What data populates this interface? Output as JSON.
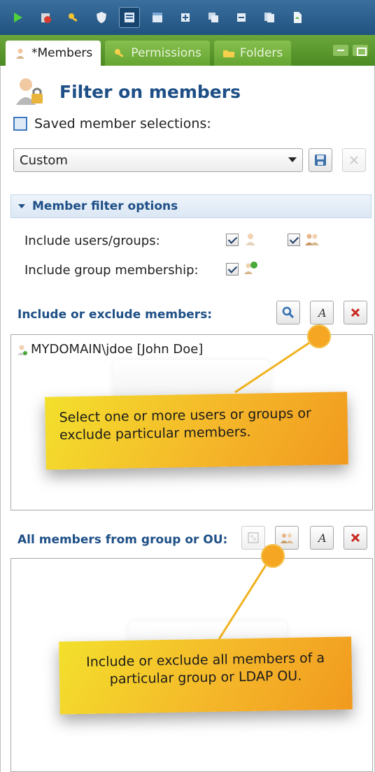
{
  "tabs": [
    {
      "label": "*Members"
    },
    {
      "label": "Permissions"
    },
    {
      "label": "Folders"
    }
  ],
  "header": {
    "title": "Filter on members"
  },
  "saved": {
    "label": "Saved member selections:",
    "selected": "Custom"
  },
  "filter_options": {
    "title": "Member filter options",
    "include_users_groups_label": "Include users/groups:",
    "include_group_membership_label": "Include group membership:"
  },
  "include_members": {
    "label": "Include or exclude members:",
    "items": [
      "MYDOMAIN\\jdoe [John Doe]"
    ],
    "callout": "Select one or more users or groups or exclude particular members."
  },
  "group_members": {
    "label": "All members from group or OU:",
    "callout": "Include or exclude all members of a particular group or LDAP OU."
  },
  "colors": {
    "accent": "#1e4f86",
    "tab_green": "#5e9c2f",
    "callout": "#f5b72a"
  }
}
